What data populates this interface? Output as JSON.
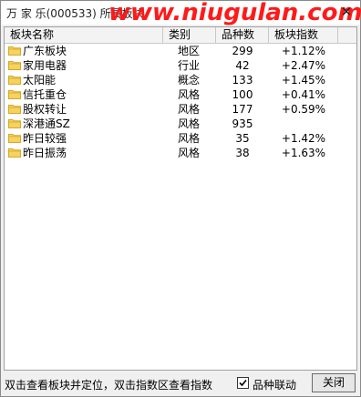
{
  "window": {
    "title": "万 家 乐(000533) 所属板块",
    "watermark": "www.niugulan.com",
    "close_symbol": "✕"
  },
  "columns": [
    "板块名称",
    "类别",
    "品种数",
    "板块指数"
  ],
  "rows": [
    {
      "name": "广东板块",
      "type": "地区",
      "count": "299",
      "change": "+1.12%"
    },
    {
      "name": "家用电器",
      "type": "行业",
      "count": "42",
      "change": "+2.47%"
    },
    {
      "name": "太阳能",
      "type": "概念",
      "count": "133",
      "change": "+1.45%"
    },
    {
      "name": "信托重仓",
      "type": "风格",
      "count": "100",
      "change": "+0.41%"
    },
    {
      "name": "股权转让",
      "type": "风格",
      "count": "177",
      "change": "+0.59%"
    },
    {
      "name": "深港通SZ",
      "type": "风格",
      "count": "935",
      "change": ""
    },
    {
      "name": "昨日较强",
      "type": "风格",
      "count": "35",
      "change": "+1.42%"
    },
    {
      "name": "昨日振荡",
      "type": "风格",
      "count": "38",
      "change": "+1.63%"
    }
  ],
  "status": {
    "hint": "双击查看板块并定位，双击指数区查看指数",
    "checkbox_label": "品种联动",
    "checkbox_checked": true,
    "close_button": "关闭"
  },
  "icons": {
    "row_icon": "folder-icon",
    "checkbox": "checkmark-icon"
  },
  "colors": {
    "folder_fill": "#f5d35c",
    "folder_dark": "#d8a62a",
    "watermark": "#ff1a1a"
  }
}
